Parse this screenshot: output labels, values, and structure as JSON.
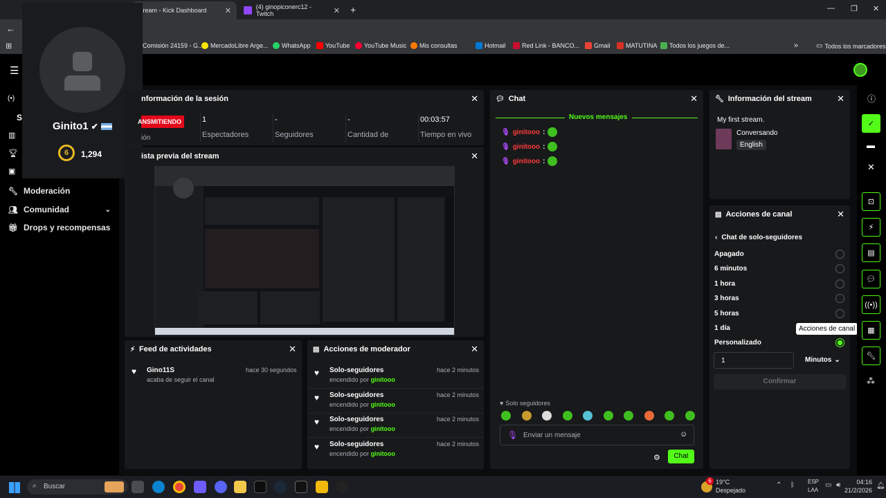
{
  "browser": {
    "tabs": [
      {
        "label": "Stream - Kick Dashboard"
      },
      {
        "label": "(4) ginopiconerc12 - Twitch"
      }
    ],
    "url": "am",
    "bookmarks": [
      "Comisión 24159 - G...",
      "MercadoLibre Arge...",
      "WhatsApp",
      "YouTube",
      "YouTube Music",
      "Mis consultas",
      "Hotmail",
      "Red Link - BANCO...",
      "Gmail",
      "MATUTINA",
      "Todos los juegos de..."
    ],
    "all_bookmarks": "Todos los marcadores"
  },
  "profile": {
    "name": "Ginito1",
    "level": "6",
    "points": "1,294"
  },
  "leftnav": {
    "items": [
      "S",
      "Moderación",
      "Comunidad",
      "Drops y recompensas"
    ]
  },
  "session": {
    "title": "nformación de la sesión",
    "status": "ANSMITIENDO",
    "sub": "ión",
    "stats": [
      {
        "value": "1",
        "label": "Espectadores"
      },
      {
        "value": "-",
        "label": "Seguidores"
      },
      {
        "value": "-",
        "label": "Cantidad de"
      },
      {
        "value": "00:03:57",
        "label": "Tiempo en vivo"
      }
    ]
  },
  "preview": {
    "title": "ista previa del stream"
  },
  "chat": {
    "title": "Chat",
    "new_messages": "Nuevos mensajes",
    "messages": [
      {
        "user": "ginitooo"
      },
      {
        "user": "ginitooo"
      },
      {
        "user": "ginitooo"
      }
    ],
    "mode": "Solo seguidores",
    "placeholder": "Enviar un mensaje",
    "send": "Chat"
  },
  "stream_info": {
    "title": "Información del stream",
    "stream_title": "My first stream.",
    "category": "Conversando",
    "language": "English"
  },
  "channel_actions": {
    "title": "Acciones de canal",
    "subtitle": "Chat de solo-seguidores",
    "options": [
      "Apagado",
      "6 minutos",
      "1 hora",
      "3 horas",
      "5 horas",
      "1 día",
      "Personalizado"
    ],
    "selected": "Personalizado",
    "input_value": "1",
    "unit": "Minutos",
    "confirm": "Confirmar",
    "tooltip": "Acciones de canal"
  },
  "feed": {
    "title": "Feed de actividades",
    "items": [
      {
        "user": "Gino11S",
        "time": "hace 30 segundos",
        "text": "acaba de seguir el canal"
      }
    ]
  },
  "mod_actions": {
    "title": "Acciones de moderador",
    "items": [
      {
        "title": "Solo-seguidores",
        "by": "encendido por",
        "user": "ginitooo",
        "time": "hace 2 minutos"
      },
      {
        "title": "Solo-seguidores",
        "by": "encendido por",
        "user": "ginitooo",
        "time": "hace 2 minutos"
      },
      {
        "title": "Solo-seguidores",
        "by": "encendido por",
        "user": "ginitooo",
        "time": "hace 2 minutos"
      },
      {
        "title": "Solo-seguidores",
        "by": "encendido por",
        "user": "ginitooo",
        "time": "hace 2 minutos"
      }
    ]
  },
  "taskbar": {
    "search": "Buscar",
    "temp": "19°C",
    "weather": "Despejado",
    "lang1": "ESP",
    "lang2": "LAA",
    "time": "04:16",
    "date": "21/2/2026",
    "badge": "6"
  },
  "colors": {
    "accent": "#53fc18",
    "live": "#e3091c",
    "bg": "#0b0c0e",
    "panel": "#18191b"
  }
}
